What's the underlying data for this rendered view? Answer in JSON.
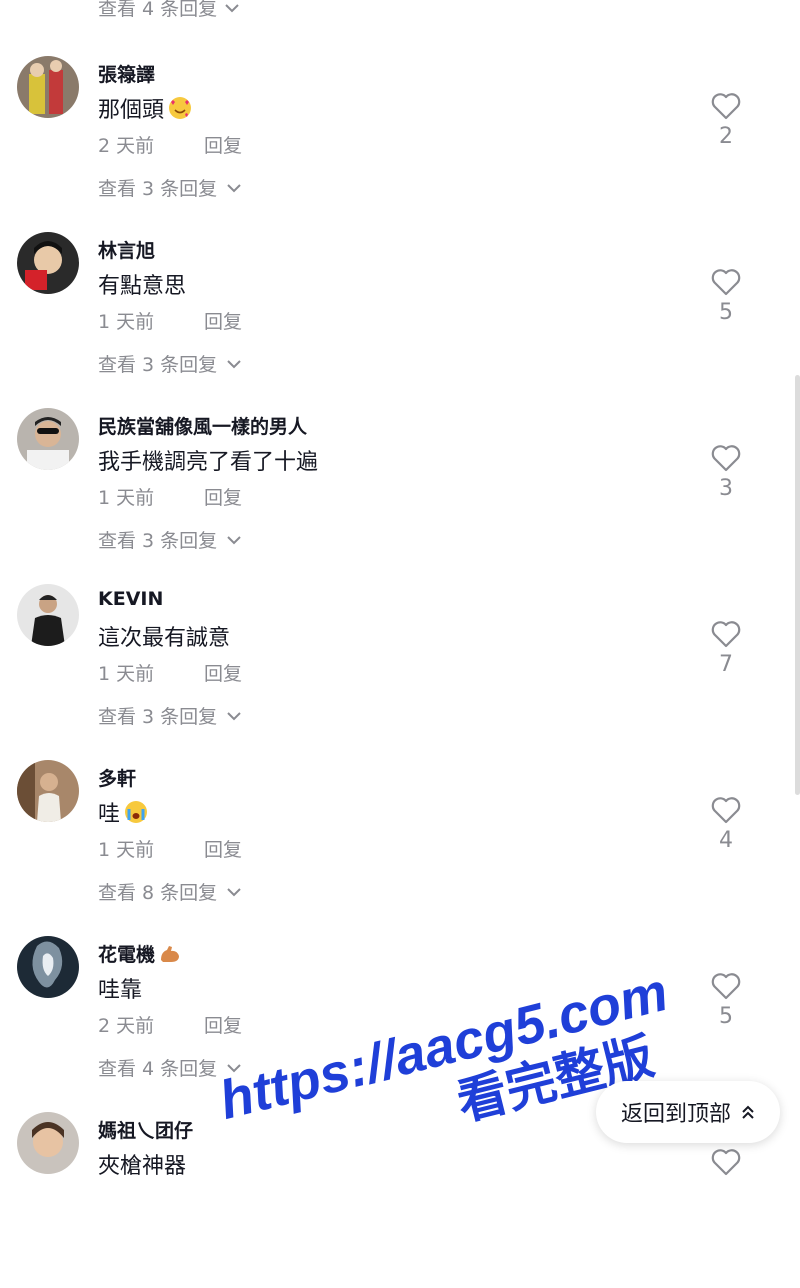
{
  "top_replies": {
    "label": "查看 4 条回复"
  },
  "comments": [
    {
      "username": "張簶譯",
      "text": "那個頭",
      "emoji": "smiling-face-with-hearts",
      "time": "2 天前",
      "reply": "回复",
      "likes": "2",
      "replies": "查看 3 条回复"
    },
    {
      "username": "林言旭",
      "text": "有點意思",
      "emoji": "",
      "time": "1 天前",
      "reply": "回复",
      "likes": "5",
      "replies": "查看 3 条回复"
    },
    {
      "username": "民族當舖像風一樣的男人",
      "text": "我手機調亮了看了十遍",
      "emoji": "",
      "time": "1 天前",
      "reply": "回复",
      "likes": "3",
      "replies": "查看 3 条回复"
    },
    {
      "username": "KEVIN",
      "text": "這次最有誠意",
      "emoji": "",
      "time": "1 天前",
      "reply": "回复",
      "likes": "7",
      "replies": "查看 3 条回复"
    },
    {
      "username": "多軒",
      "text": "哇",
      "emoji": "crying-face",
      "time": "1 天前",
      "reply": "回复",
      "likes": "4",
      "replies": "查看 8 条回复"
    },
    {
      "username": "花電機",
      "username_emoji": "flexed-biceps",
      "text": "哇靠",
      "emoji": "",
      "time": "2 天前",
      "reply": "回复",
      "likes": "5",
      "replies": "查看 4 条回复"
    },
    {
      "username": "媽祖乀团仔",
      "text": "夾槍神器",
      "emoji": "",
      "time": "",
      "reply": "",
      "likes": "",
      "replies": ""
    }
  ],
  "back_to_top": {
    "label": "返回到顶部"
  },
  "watermark": {
    "line1": "https://aacg5.com",
    "line2": "看完整版"
  },
  "colors": {
    "text": "#161823",
    "muted": "#8a8b91",
    "watermark": "#1f3fd8"
  }
}
